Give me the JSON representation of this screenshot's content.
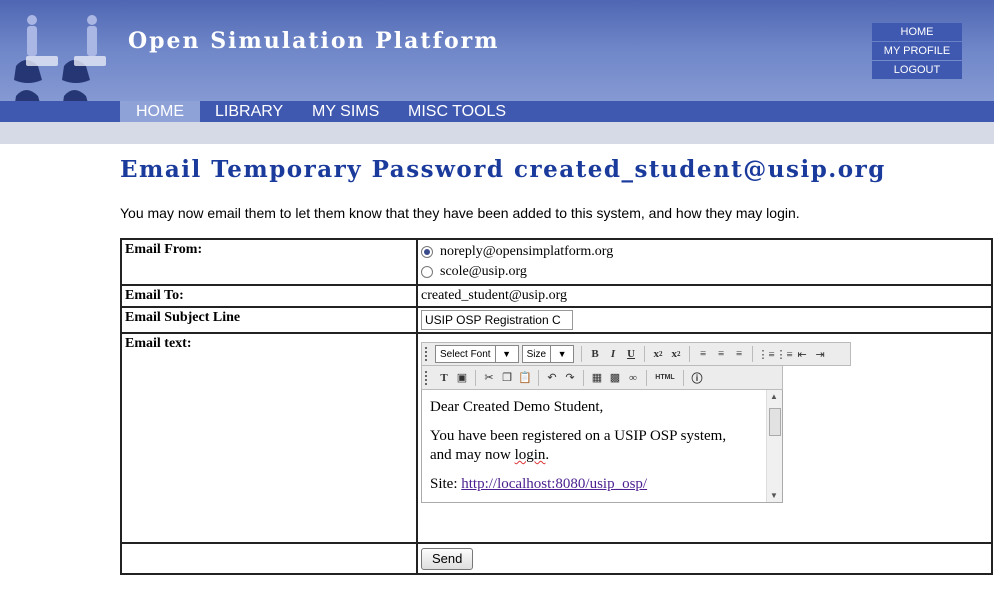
{
  "site": {
    "title": "Open Simulation Platform"
  },
  "top_links": [
    "HOME",
    "MY PROFILE",
    "LOGOUT"
  ],
  "nav": {
    "items": [
      "HOME",
      "LIBRARY",
      "MY SIMS",
      "MISC TOOLS"
    ],
    "active": "HOME"
  },
  "page": {
    "title": "Email Temporary Password created_student@usip.org",
    "intro": "You may now email them to let them know that they have been added to this system, and how they may login."
  },
  "form": {
    "email_from_label": "Email From:",
    "from_options": [
      {
        "label": "noreply@opensimplatform.org",
        "selected": true
      },
      {
        "label": "scole@usip.org",
        "selected": false
      }
    ],
    "email_to_label": "Email To:",
    "email_to_value": "created_student@usip.org",
    "subject_label": "Email Subject Line",
    "subject_value": "USIP OSP Registration C",
    "text_label": "Email text:",
    "send_label": "Send"
  },
  "editor": {
    "font_select": "Select Font",
    "size_select": "Size",
    "html_button": "HTML",
    "body": {
      "greeting": "Dear Created Demo Student,",
      "line1": "You have been registered on a USIP OSP system,",
      "line2_pre": "and may now ",
      "line2_word": "login",
      "line2_post": ".",
      "site_label": "Site: ",
      "site_link": "http://localhost:8080/usip_osp/"
    }
  },
  "colors": {
    "header": "#4f67b3",
    "nav": "#3f58b0",
    "title": "#1a3a9c"
  }
}
